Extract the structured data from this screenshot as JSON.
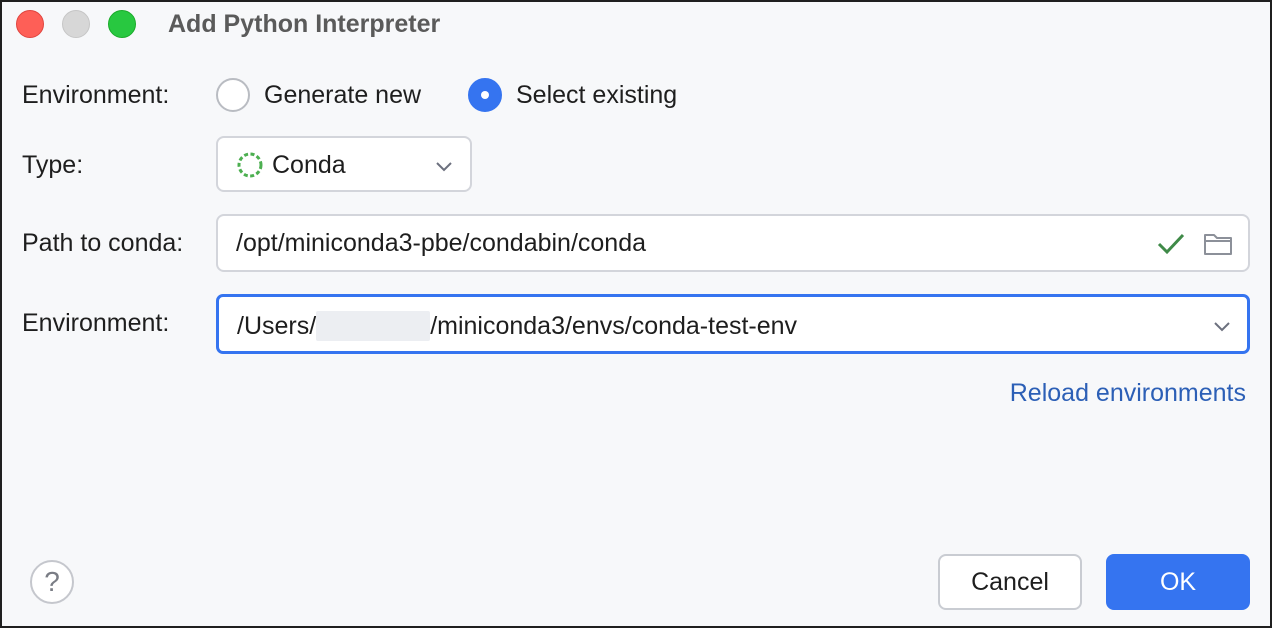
{
  "window": {
    "title": "Add Python Interpreter"
  },
  "form": {
    "environment_mode_label": "Environment:",
    "radio_generate_new": "Generate new",
    "radio_select_existing": "Select existing",
    "selected_mode": "Select existing",
    "type_label": "Type:",
    "type_value": "Conda",
    "path_label": "Path to conda:",
    "path_value": "/opt/miniconda3-pbe/condabin/conda",
    "environment_label": "Environment:",
    "environment_prefix": "/Users/",
    "environment_suffix": "/miniconda3/envs/conda-test-env",
    "reload_link": "Reload environments"
  },
  "footer": {
    "help_symbol": "?",
    "cancel_label": "Cancel",
    "ok_label": "OK"
  },
  "colors": {
    "accent": "#3574f0",
    "link": "#2c5fb6",
    "check": "#3f8a48",
    "conda_icon": "#4caf50"
  },
  "icons": [
    "conda-icon",
    "chevron-down-icon",
    "check-icon",
    "folder-icon",
    "help-icon"
  ]
}
